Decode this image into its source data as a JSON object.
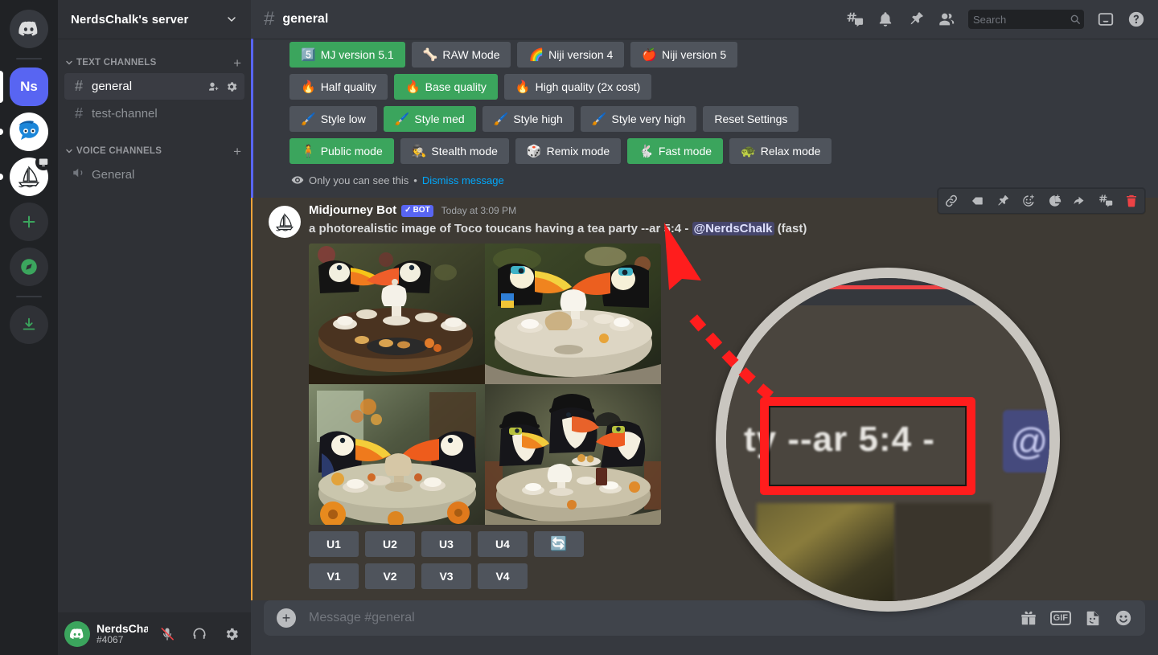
{
  "server_rail": {
    "servers": [
      {
        "name": "discord-home",
        "label": "",
        "icon": "discord-logo-icon",
        "indicator": "none"
      },
      {
        "name": "nerdschalk-server",
        "label": "Ns",
        "icon": "text-avatar",
        "indicator": "tall"
      },
      {
        "name": "blue-mascot-server",
        "label": "",
        "icon": "mascot-icon",
        "indicator": "small"
      },
      {
        "name": "midjourney-server",
        "label": "",
        "icon": "sailboat-icon",
        "indicator": "small",
        "badge": "screen-share"
      }
    ],
    "actions": [
      {
        "name": "add-server",
        "icon": "plus-icon"
      },
      {
        "name": "explore-servers",
        "icon": "compass-icon"
      },
      {
        "name": "download-apps",
        "icon": "download-icon"
      }
    ]
  },
  "sidebar": {
    "server_name": "NerdsChalk's server",
    "categories": [
      {
        "label": "TEXT CHANNELS",
        "channels": [
          {
            "name": "general",
            "active": true,
            "icons": [
              "add-member-icon",
              "gear-icon"
            ]
          },
          {
            "name": "test-channel",
            "active": false,
            "icons": []
          }
        ]
      },
      {
        "label": "VOICE CHANNELS",
        "channels": [
          {
            "name": "General",
            "active": false,
            "voice": true
          }
        ]
      }
    ],
    "user": {
      "name": "NerdsChalk",
      "discriminator": "#4067",
      "mic_state": "muted",
      "controls": [
        "mic-muted-icon",
        "headphones-icon",
        "user-settings-gear-icon"
      ]
    }
  },
  "header": {
    "hash": "#",
    "channel": "general",
    "icons": [
      "threads-icon",
      "notifications-bell-icon",
      "pinned-messages-icon",
      "member-list-icon",
      "inbox-icon",
      "help-icon"
    ],
    "search": {
      "placeholder": "Search",
      "value": ""
    }
  },
  "ephemeral": {
    "rows": [
      [
        {
          "label": "MJ version 5.1",
          "emoji": "5️⃣",
          "active": true
        },
        {
          "label": "RAW Mode",
          "emoji": "🦴",
          "active": false
        },
        {
          "label": "Niji version 4",
          "emoji": "🌈",
          "active": false
        },
        {
          "label": "Niji version 5",
          "emoji": "🍎",
          "active": false
        }
      ],
      [
        {
          "label": "Half quality",
          "emoji": "🔥",
          "active": false
        },
        {
          "label": "Base quality",
          "emoji": "🔥",
          "active": true
        },
        {
          "label": "High quality (2x cost)",
          "emoji": "🔥",
          "active": false
        }
      ],
      [
        {
          "label": "Style low",
          "emoji": "🖌️",
          "active": false
        },
        {
          "label": "Style med",
          "emoji": "🖌️",
          "active": true
        },
        {
          "label": "Style high",
          "emoji": "🖌️",
          "active": false
        },
        {
          "label": "Style very high",
          "emoji": "🖌️",
          "active": false
        },
        {
          "label": "Reset Settings",
          "emoji": "",
          "active": false
        }
      ],
      [
        {
          "label": "Public mode",
          "emoji": "🧍",
          "active": true
        },
        {
          "label": "Stealth mode",
          "emoji": "🕵️",
          "active": false
        },
        {
          "label": "Remix mode",
          "emoji": "🎲",
          "active": false
        },
        {
          "label": "Fast mode",
          "emoji": "🐇",
          "active": true
        },
        {
          "label": "Relax mode",
          "emoji": "🐢",
          "active": false
        }
      ]
    ],
    "note": "Only you can see this",
    "separator": "•",
    "dismiss": "Dismiss message"
  },
  "message": {
    "author": "Midjourney Bot",
    "bot_tag": "BOT",
    "bot_check": "✓",
    "timestamp": "Today at 3:09 PM",
    "prompt": "a photorealistic image of Toco toucans having a tea party --ar 5:4",
    "dash": "-",
    "mention": "@NerdsChalk",
    "suffix": "(fast)",
    "attachment_alt": "2x2 grid of photorealistic Toco toucans having a tea party",
    "hover_actions": [
      {
        "name": "copy-link-icon",
        "label": "link"
      },
      {
        "name": "tag-icon",
        "label": "tag"
      },
      {
        "name": "pin-icon",
        "label": "pin"
      },
      {
        "name": "add-reaction-icon",
        "label": "react"
      },
      {
        "name": "add-sticker-icon",
        "label": "sticker"
      },
      {
        "name": "reply-icon",
        "label": "reply"
      },
      {
        "name": "create-thread-icon",
        "label": "thread"
      },
      {
        "name": "delete-icon",
        "label": "delete"
      }
    ],
    "upscale_buttons": [
      "U1",
      "U2",
      "U3",
      "U4"
    ],
    "reroll_button": "🔄",
    "variation_buttons": [
      "V1",
      "V2",
      "V3",
      "V4"
    ]
  },
  "composer": {
    "placeholder": "Message #general",
    "value": "",
    "icons": [
      "gift-icon",
      "gif-icon",
      "sticker-icon",
      "emoji-icon"
    ],
    "gif_label": "GIF"
  },
  "annotation": {
    "magnified_text": "--ar 5:4 -",
    "magnified_prefix": "ty",
    "magnified_mention": "@",
    "highlight_color": "#ff1d1d",
    "arrow_color": "#ff1d1d",
    "ring_color": "#c9c6c0"
  },
  "colors": {
    "brand": "#5865f2",
    "green": "#3ba55d",
    "danger": "#ed4245",
    "accent_bar": "#f0a43a",
    "link": "#00a8fc"
  }
}
